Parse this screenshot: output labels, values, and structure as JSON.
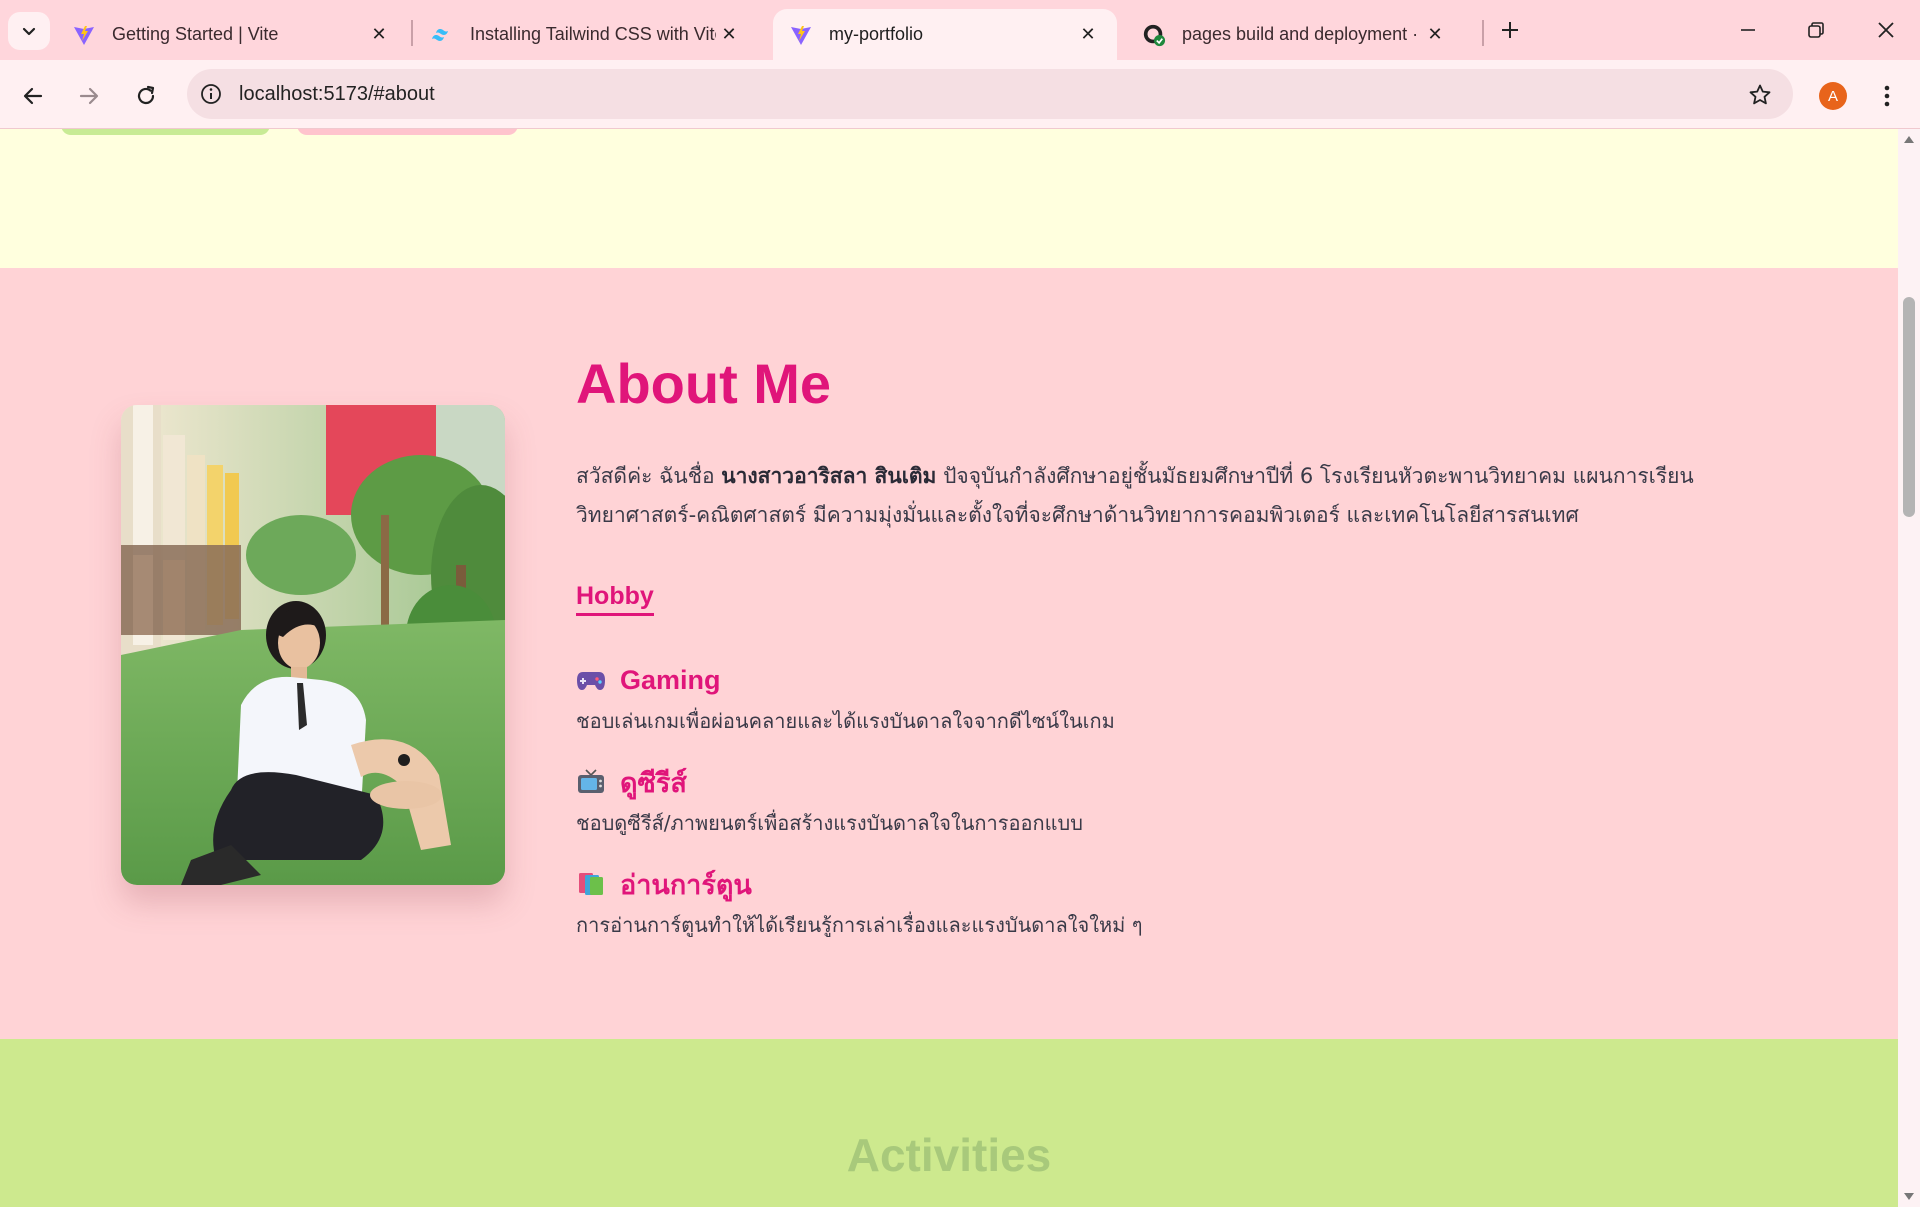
{
  "browser": {
    "tabs": [
      {
        "title": "Getting Started | Vite",
        "icon": "vite-icon",
        "active": false
      },
      {
        "title": "Installing Tailwind CSS with Vite",
        "icon": "tailwind-icon",
        "active": false
      },
      {
        "title": "my-portfolio",
        "icon": "vite-icon",
        "active": true
      },
      {
        "title": "pages build and deployment · Y",
        "icon": "github-icon",
        "active": false
      }
    ],
    "url": "localhost:5173/#about",
    "profile_initial": "A",
    "profile_color": "#e8641b"
  },
  "about": {
    "title": "About Me",
    "bio_intro": "สวัสดีค่ะ ฉันชื่อ ",
    "bio_name": "นางสาวอาริสลา สินเติม",
    "bio_rest": " ปัจจุบันกำลังศึกษาอยู่ชั้นมัธยมศึกษาปีที่ 6 โรงเรียนหัวตะพานวิทยาคม แผนการเรียนวิทยาศาสตร์-คณิตศาสตร์ มีความมุ่งมั่นและตั้งใจที่จะศึกษาด้านวิทยาการคอมพิวเตอร์ และเทคโนโลยีสารสนเทศ",
    "hobby_heading": "Hobby",
    "hobbies": [
      {
        "icon": "game-controller-icon",
        "title": "Gaming",
        "desc": "ชอบเล่นเกมเพื่อผ่อนคลายและได้แรงบันดาลใจจากดีไซน์ในเกม"
      },
      {
        "icon": "television-icon",
        "title": "ดูซีรีส์",
        "desc": "ชอบดูซีรีส์/ภาพยนตร์เพื่อสร้างแรงบันดาลใจในการออกแบบ"
      },
      {
        "icon": "books-icon",
        "title": "อ่านการ์ตูน",
        "desc": "การอ่านการ์ตูนทำให้ได้เรียนรู้การเล่าเรื่องและแรงบันดาลใจใหม่ ๆ"
      }
    ],
    "accent_color": "#e0157a"
  },
  "activities": {
    "title": "Activities"
  }
}
